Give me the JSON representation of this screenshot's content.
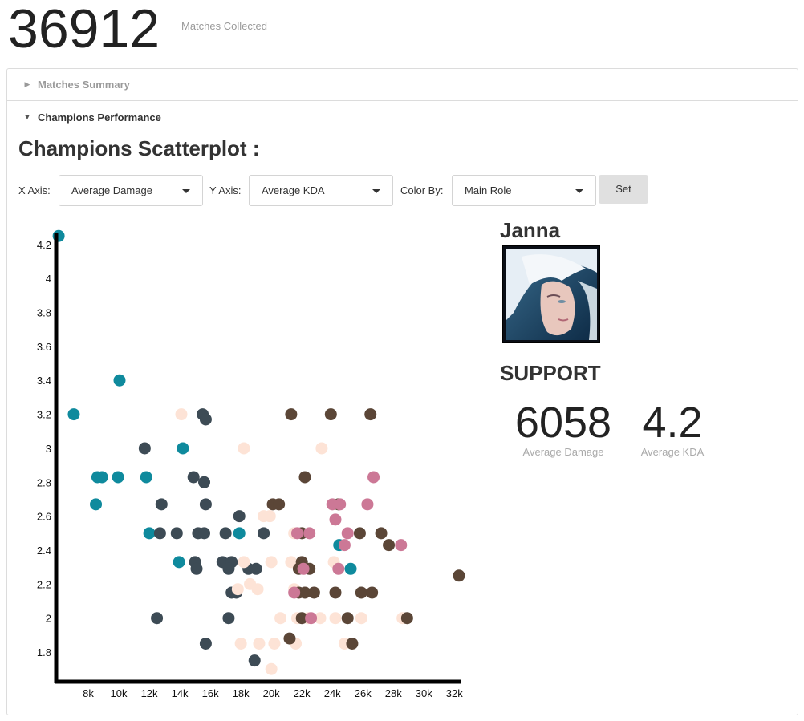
{
  "header": {
    "matches_count": "36912",
    "matches_caption": "Matches Collected"
  },
  "accordion": {
    "matches_summary": "Matches Summary",
    "champions_performance": "Champions Performance"
  },
  "scatter": {
    "title": "Champions Scatterplot :",
    "x_axis_label": "X Axis:",
    "x_axis_value": "Average Damage",
    "y_axis_label": "Y Axis:",
    "y_axis_value": "Average KDA",
    "color_by_label": "Color By:",
    "color_by_value": "Main Role",
    "set_label": "Set"
  },
  "selected": {
    "name": "Janna",
    "role": "SUPPORT",
    "damage": "6058",
    "damage_caption": "Average Damage",
    "kda": "4.2",
    "kda_caption": "Average KDA",
    "portrait_icon": "janna-portrait-icon"
  },
  "colors": {
    "teal": "#0f8a9d",
    "slate": "#3d4b55",
    "peach": "#fde3d6",
    "brown": "#5b4637",
    "pink": "#cc7896"
  },
  "chart_data": {
    "type": "scatter",
    "xlabel": "",
    "ylabel": "",
    "xlim": [
      6000,
      32300
    ],
    "ylim": [
      1.72,
      4.27
    ],
    "x_ticks": [
      "8k",
      "10k",
      "12k",
      "14k",
      "16k",
      "18k",
      "20k",
      "22k",
      "24k",
      "26k",
      "28k",
      "30k",
      "32k"
    ],
    "y_ticks": [
      "1.8",
      "2",
      "2.2",
      "2.4",
      "2.6",
      "2.8",
      "3",
      "3.2",
      "3.4",
      "3.6",
      "3.8",
      "4",
      "4.2"
    ],
    "series": [
      {
        "color": "#0f8a9d",
        "points": [
          [
            6058,
            4.25
          ],
          [
            7050,
            3.2
          ],
          [
            10050,
            3.4
          ],
          [
            8600,
            2.83
          ],
          [
            8900,
            2.83
          ],
          [
            9950,
            2.83
          ],
          [
            11800,
            2.83
          ],
          [
            8500,
            2.67
          ],
          [
            14200,
            3.0
          ],
          [
            12000,
            2.5
          ],
          [
            13950,
            2.33
          ],
          [
            17900,
            2.5
          ],
          [
            24450,
            2.43
          ],
          [
            25200,
            2.29
          ]
        ]
      },
      {
        "color": "#3d4b55",
        "points": [
          [
            15500,
            3.2
          ],
          [
            15700,
            3.17
          ],
          [
            11700,
            3.0
          ],
          [
            14900,
            2.83
          ],
          [
            15600,
            2.8
          ],
          [
            12800,
            2.67
          ],
          [
            15700,
            2.67
          ],
          [
            12700,
            2.5
          ],
          [
            13800,
            2.5
          ],
          [
            15200,
            2.5
          ],
          [
            15600,
            2.5
          ],
          [
            17000,
            2.5
          ],
          [
            19500,
            2.5
          ],
          [
            17900,
            2.6
          ],
          [
            15000,
            2.33
          ],
          [
            15100,
            2.29
          ],
          [
            16800,
            2.33
          ],
          [
            17400,
            2.33
          ],
          [
            17200,
            2.29
          ],
          [
            18500,
            2.29
          ],
          [
            19000,
            2.29
          ],
          [
            17400,
            2.15
          ],
          [
            17700,
            2.15
          ],
          [
            12500,
            2.0
          ],
          [
            17200,
            2.0
          ],
          [
            15700,
            1.85
          ],
          [
            18900,
            1.75
          ]
        ]
      },
      {
        "color": "#fde3d6",
        "points": [
          [
            14100,
            3.2
          ],
          [
            18200,
            3.0
          ],
          [
            23300,
            3.0
          ],
          [
            19500,
            2.6
          ],
          [
            19900,
            2.6
          ],
          [
            21500,
            2.5
          ],
          [
            18200,
            2.33
          ],
          [
            20000,
            2.33
          ],
          [
            21300,
            2.33
          ],
          [
            24100,
            2.33
          ],
          [
            17800,
            2.17
          ],
          [
            18600,
            2.2
          ],
          [
            19100,
            2.17
          ],
          [
            21500,
            2.17
          ],
          [
            20600,
            2.0
          ],
          [
            21700,
            2.0
          ],
          [
            22400,
            2.0
          ],
          [
            23200,
            2.0
          ],
          [
            24200,
            2.0
          ],
          [
            25900,
            2.0
          ],
          [
            28600,
            2.0
          ],
          [
            18000,
            1.85
          ],
          [
            19200,
            1.85
          ],
          [
            20200,
            1.85
          ],
          [
            21600,
            1.85
          ],
          [
            24800,
            1.85
          ],
          [
            20000,
            1.7
          ]
        ]
      },
      {
        "color": "#5b4637",
        "points": [
          [
            21300,
            3.2
          ],
          [
            23900,
            3.2
          ],
          [
            26500,
            3.2
          ],
          [
            22200,
            2.83
          ],
          [
            20100,
            2.67
          ],
          [
            20500,
            2.67
          ],
          [
            24400,
            2.67
          ],
          [
            22000,
            2.5
          ],
          [
            25800,
            2.5
          ],
          [
            27200,
            2.5
          ],
          [
            27700,
            2.43
          ],
          [
            22000,
            2.33
          ],
          [
            21800,
            2.29
          ],
          [
            22500,
            2.29
          ],
          [
            21800,
            2.15
          ],
          [
            22200,
            2.15
          ],
          [
            22800,
            2.15
          ],
          [
            24200,
            2.15
          ],
          [
            25900,
            2.15
          ],
          [
            26600,
            2.15
          ],
          [
            32300,
            2.25
          ],
          [
            22000,
            2.0
          ],
          [
            25000,
            2.0
          ],
          [
            28900,
            2.0
          ],
          [
            21200,
            1.88
          ],
          [
            25300,
            1.85
          ]
        ]
      },
      {
        "color": "#cc7896",
        "points": [
          [
            26700,
            2.83
          ],
          [
            24000,
            2.67
          ],
          [
            24500,
            2.67
          ],
          [
            26300,
            2.67
          ],
          [
            24200,
            2.58
          ],
          [
            21700,
            2.5
          ],
          [
            22500,
            2.5
          ],
          [
            25000,
            2.5
          ],
          [
            24800,
            2.43
          ],
          [
            28500,
            2.43
          ],
          [
            22100,
            2.29
          ],
          [
            24400,
            2.29
          ],
          [
            21500,
            2.15
          ],
          [
            22600,
            2.0
          ]
        ]
      }
    ]
  }
}
